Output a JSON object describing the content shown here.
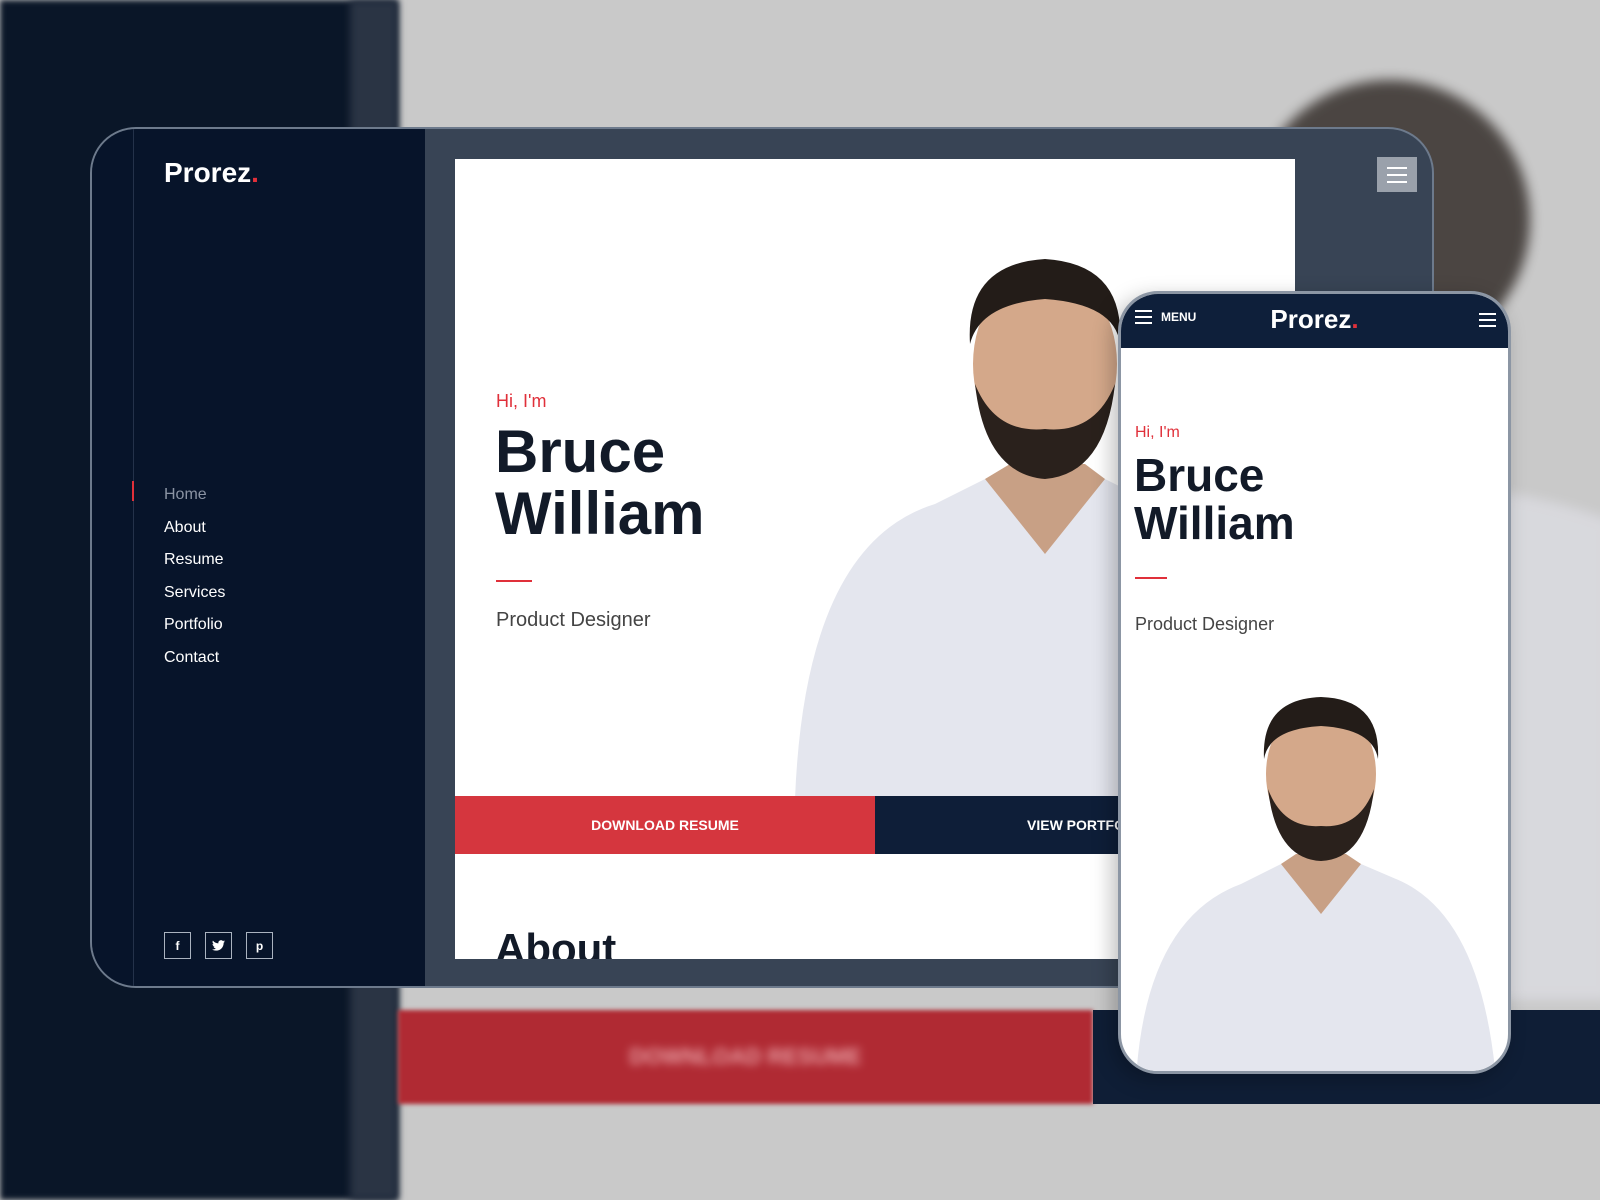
{
  "brand": {
    "name": "Prorez",
    "dot": ".",
    "accent": "#e0303a",
    "navy": "#0e1e38"
  },
  "sidebar": {
    "items": [
      {
        "label": "Home",
        "active": true
      },
      {
        "label": "About"
      },
      {
        "label": "Resume"
      },
      {
        "label": "Services"
      },
      {
        "label": "Portfolio"
      },
      {
        "label": "Contact"
      }
    ],
    "social": [
      {
        "icon": "facebook-icon",
        "glyph": "f"
      },
      {
        "icon": "twitter-icon",
        "glyph": "t"
      },
      {
        "icon": "pinterest-icon",
        "glyph": "p"
      }
    ]
  },
  "hero": {
    "greeting": "Hi, I'm",
    "first_name": "Bruce",
    "last_name": "William",
    "role": "Product Designer"
  },
  "buttons": {
    "download": "DOWNLOAD RESUME",
    "portfolio": "VIEW PORTFOLIO"
  },
  "sections": {
    "about": "About"
  },
  "mobile": {
    "menu_label": "MENU"
  }
}
